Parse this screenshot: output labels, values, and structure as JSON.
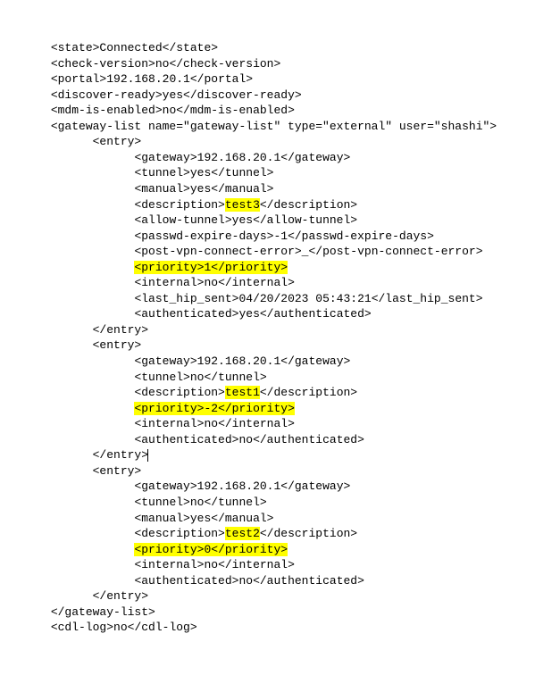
{
  "indent1": "      ",
  "indent2": "            ",
  "indent3": "                  ",
  "state_open": "<state>",
  "state_val": "Connected",
  "state_close": "</state>",
  "checkver_open": "<check-version>",
  "checkver_val": "no",
  "checkver_close": "</check-version>",
  "portal_open": "<portal>",
  "portal_val": "192.168.20.1",
  "portal_close": "</portal>",
  "discover_open": "<discover-ready>",
  "discover_val": "yes",
  "discover_close": "</discover-ready>",
  "mdm_open": "<mdm-is-enabled>",
  "mdm_val": "no",
  "mdm_close": "</mdm-is-enabled>",
  "gwlist_open": "<gateway-list name=\"gateway-list\" type=\"external\" user=\"shashi\">",
  "entry_open": "<entry>",
  "entry_close": "</entry>",
  "gw_open": "<gateway>",
  "gw_val": "192.168.20.1",
  "gw_close": "</gateway>",
  "tunnel_open": "<tunnel>",
  "tunnel_yes": "yes",
  "tunnel_no": "no",
  "tunnel_close": "</tunnel>",
  "manual_open": "<manual>",
  "manual_yes": "yes",
  "manual_close": "</manual>",
  "desc_open": "<description>",
  "desc_close": "</description>",
  "desc_test3": "test3",
  "desc_test1": "test1",
  "desc_test2": "test2",
  "allow_open": "<allow-tunnel>",
  "allow_val": "yes",
  "allow_close": "</allow-tunnel>",
  "pwd_open": "<passwd-expire-days>",
  "pwd_val": "-1",
  "pwd_close": "</passwd-expire-days>",
  "post_open": "<post-vpn-connect-error>",
  "post_val": "_",
  "post_close": "</post-vpn-connect-error>",
  "pri_open": "<priority>",
  "pri_close": "</priority>",
  "pri_1": "1",
  "pri_n2": "-2",
  "pri_0": "0",
  "int_open": "<internal>",
  "int_val": "no",
  "int_close": "</internal>",
  "hip_open": "<last_hip_sent>",
  "hip_val": "04/20/2023 05:43:21",
  "hip_close": "</last_hip_sent>",
  "auth_open": "<authenticated>",
  "auth_yes": "yes",
  "auth_no": "no",
  "auth_close": "</authenticated>",
  "gwlist_close": "</gateway-list>",
  "cdl_open": "<cdl-log>",
  "cdl_val": "no",
  "cdl_close": "</cdl-log>"
}
